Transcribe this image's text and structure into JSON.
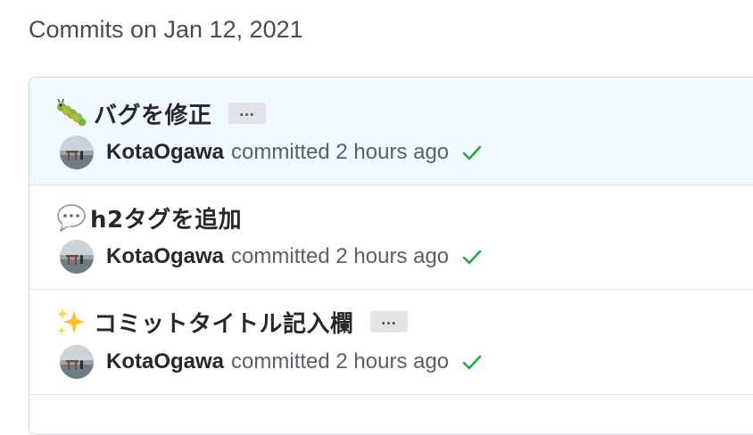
{
  "group": {
    "title": "Commits on Jan 12, 2021"
  },
  "commits": [
    {
      "emoji": "caterpillar-emoji",
      "title": "バグを修正",
      "has_ellipsis": true,
      "ellipsis_label": "…",
      "author": "KotaOgawa",
      "action": "committed 2 hours ago",
      "status": "check-icon"
    },
    {
      "emoji": "speech-balloon-emoji",
      "title": "h2タグを追加",
      "has_ellipsis": false,
      "author": "KotaOgawa",
      "action": "committed 2 hours ago",
      "status": "check-icon"
    },
    {
      "emoji": "sparkles-emoji",
      "title": "コミットタイトル記入欄",
      "has_ellipsis": true,
      "ellipsis_label": "…",
      "author": "KotaOgawa",
      "action": "committed 2 hours ago",
      "status": "check-icon"
    }
  ],
  "colors": {
    "highlight_row": "#f1f8ff",
    "border": "#d1d5da",
    "success": "#28a745",
    "muted_text": "#586069"
  }
}
